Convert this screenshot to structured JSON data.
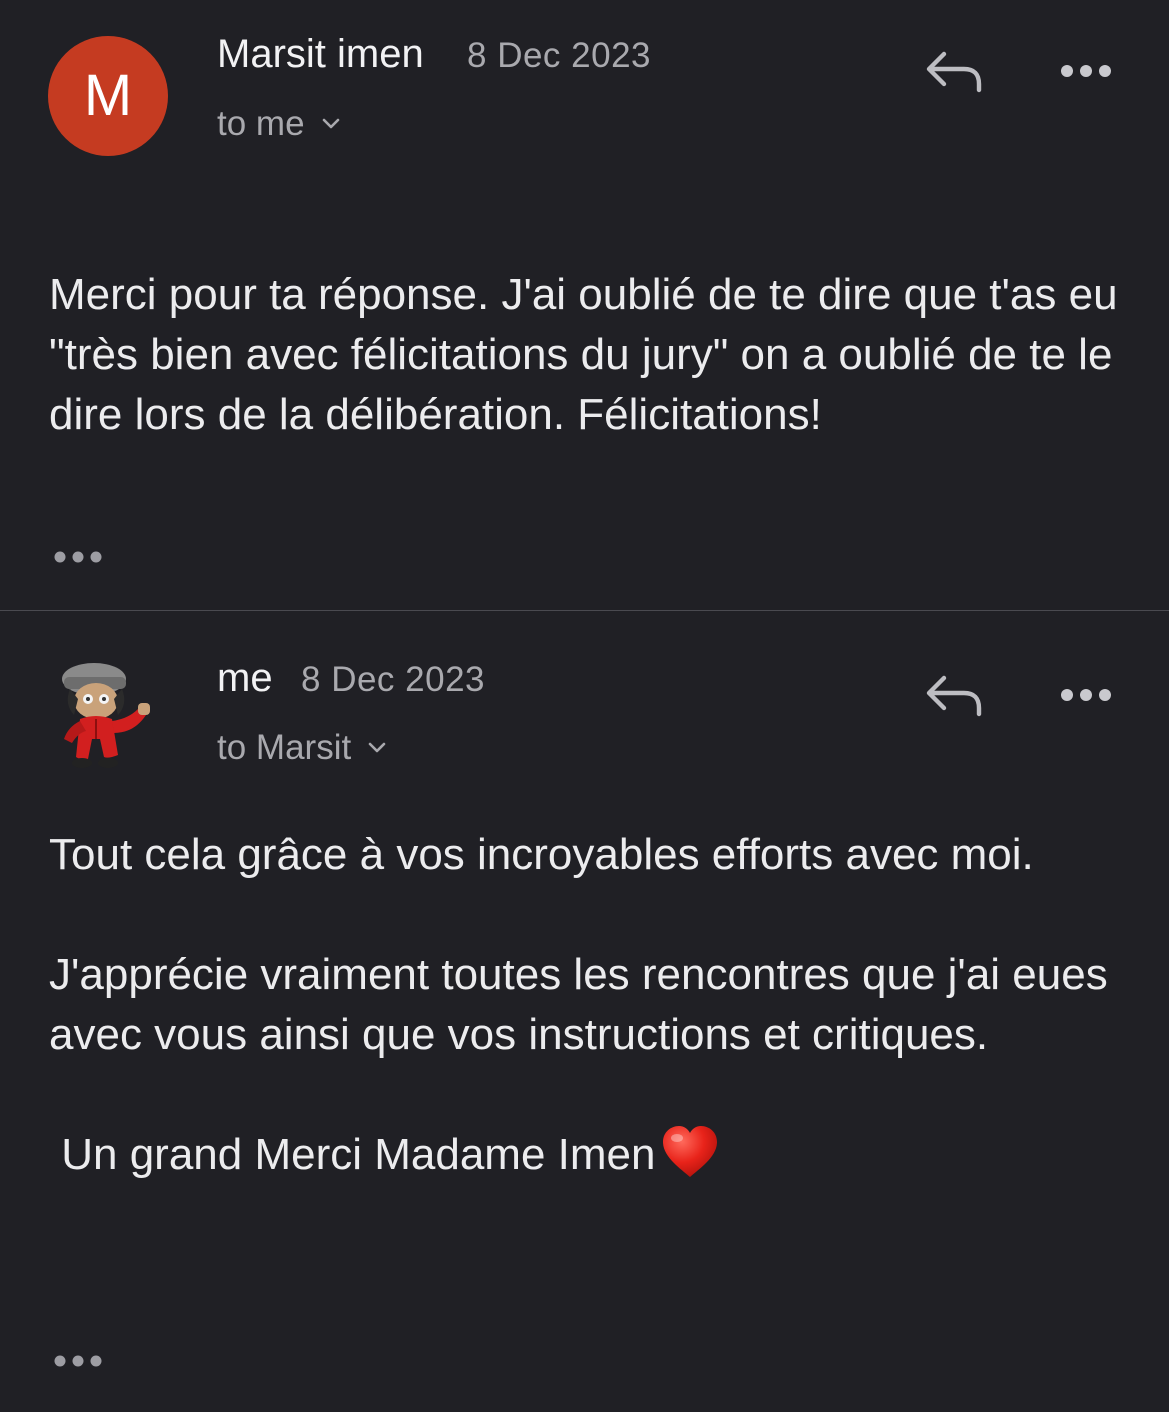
{
  "messages": [
    {
      "avatar_letter": "M",
      "sender": "Marsit imen",
      "date": "8 Dec 2023",
      "recipient": "to me",
      "body": [
        "Merci pour ta réponse. J'ai oublié de te dire que t'as eu  \"très bien avec félicitations du jury\" on a oublié de te le dire lors de la délibération. Félicitations!"
      ]
    },
    {
      "avatar_icon": "cartoon-avatar-icon",
      "sender": "me",
      "date": "8 Dec 2023",
      "recipient": "to Marsit",
      "body": [
        "Tout cela grâce à vos incroyables efforts avec moi.",
        "J'apprécie vraiment toutes les rencontres que j'ai eues avec vous ainsi que vos instructions et critiques.",
        " Un grand Merci Madame Imen"
      ],
      "closing_emoji": "heart-emoji"
    }
  ],
  "icons": {
    "reply": "reply-arrow-icon",
    "more": "more-horizontal-icon",
    "expand_recipients": "chevron-down-icon",
    "trimmed_content": "ellipsis-icon"
  },
  "colors": {
    "background": "#202025",
    "avatar_m": "#c53b21",
    "divider": "#4a4a50",
    "secondary_text": "#a9a9ae"
  }
}
